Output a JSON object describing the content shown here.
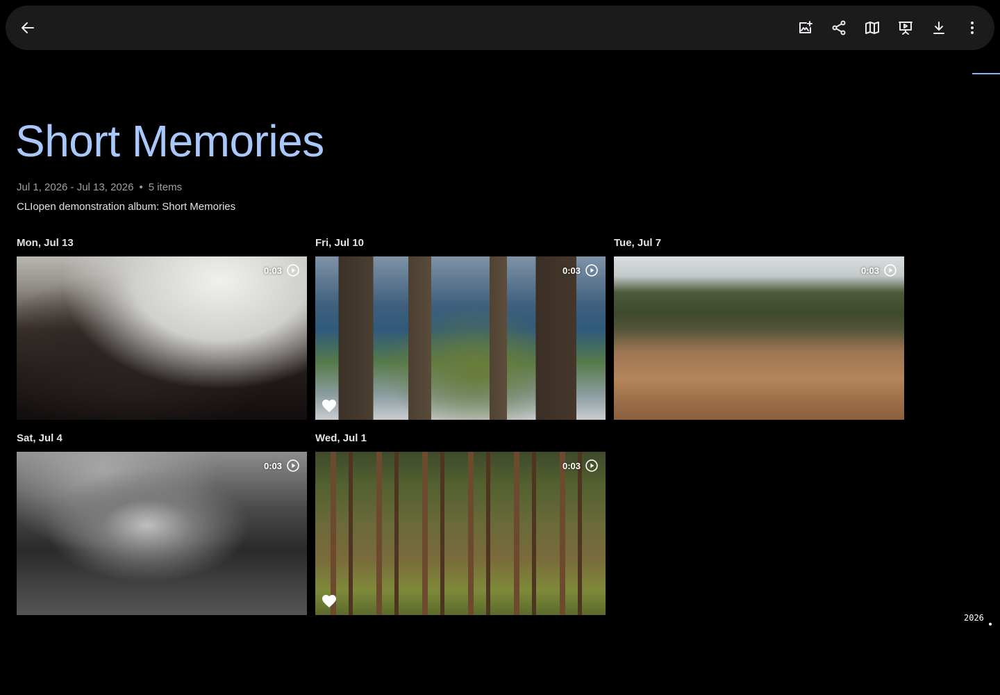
{
  "toolbar": {
    "back_icon": "arrow-left-icon",
    "actions": [
      {
        "name": "add-photos",
        "icon": "add-photo-icon"
      },
      {
        "name": "share",
        "icon": "share-icon"
      },
      {
        "name": "map",
        "icon": "map-icon"
      },
      {
        "name": "slideshow",
        "icon": "slideshow-icon"
      },
      {
        "name": "download",
        "icon": "download-icon"
      },
      {
        "name": "more-options",
        "icon": "more-vert-icon"
      }
    ]
  },
  "album": {
    "title": "Short Memories",
    "date_range": "Jul 1, 2026 - Jul 13, 2026",
    "separator": "•",
    "item_count": "5 items",
    "description": "CLIopen demonstration album: Short Memories"
  },
  "items": [
    {
      "date": "Mon, Jul 13",
      "duration": "0:03",
      "favorite": false,
      "scene": "car-interior"
    },
    {
      "date": "Fri, Jul 10",
      "duration": "0:03",
      "favorite": true,
      "scene": "pier-ocean"
    },
    {
      "date": "Tue, Jul 7",
      "duration": "0:03",
      "favorite": false,
      "scene": "grass-field"
    },
    {
      "date": "Sat, Jul 4",
      "duration": "0:03",
      "favorite": false,
      "scene": "underwater"
    },
    {
      "date": "Wed, Jul 1",
      "duration": "0:03",
      "favorite": true,
      "scene": "pine-forest"
    }
  ],
  "timeline": {
    "year": "2026"
  },
  "colors": {
    "accent": "#a8c7fa",
    "toolbar_bg": "#1b1b1b",
    "page_bg": "#000000"
  }
}
